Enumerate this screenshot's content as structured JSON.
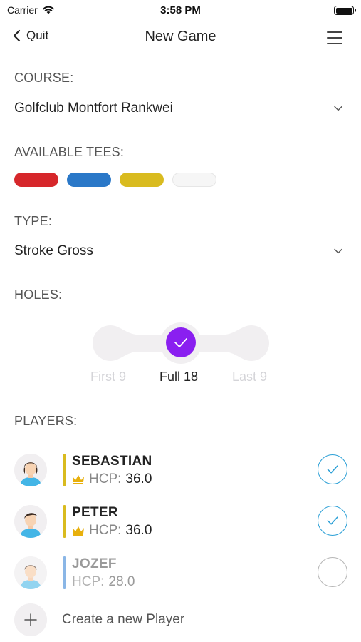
{
  "status_bar": {
    "carrier": "Carrier",
    "time": "3:58 PM",
    "icons": [
      "wifi-icon",
      "battery-icon"
    ]
  },
  "nav": {
    "back_label": "Quit",
    "title": "New Game",
    "icons": [
      "chevron-left-icon",
      "menu-icon"
    ]
  },
  "course": {
    "label": "COURSE:",
    "value": "Golfclub Montfort Rankwei"
  },
  "tees": {
    "label": "AVAILABLE TEES:",
    "colors": [
      "#d6272b",
      "#2a78c8",
      "#d9bb1f",
      "#f6f6f6"
    ]
  },
  "type": {
    "label": "TYPE:",
    "value": "Stroke Gross"
  },
  "holes": {
    "label": "HOLES:",
    "options": [
      "First 9",
      "Full 18",
      "Last 9"
    ],
    "selected": "Full 18",
    "accent_color": "#8a1ff0"
  },
  "players": {
    "label": "PLAYERS:",
    "hcp_label": "HCP:",
    "list": [
      {
        "name": "SEBASTIAN",
        "hcp": "36.0",
        "selected": true,
        "bar_color": "#d9bb1f",
        "crown": true
      },
      {
        "name": "PETER",
        "hcp": "36.0",
        "selected": true,
        "bar_color": "#d9bb1f",
        "crown": true
      },
      {
        "name": "JOZEF",
        "hcp": "28.0",
        "selected": false,
        "bar_color": "#8ab6e6",
        "crown": false
      }
    ],
    "create_label": "Create a new Player"
  },
  "colors": {
    "check_accent": "#2a9fd6",
    "crown": "#e8b00c"
  }
}
